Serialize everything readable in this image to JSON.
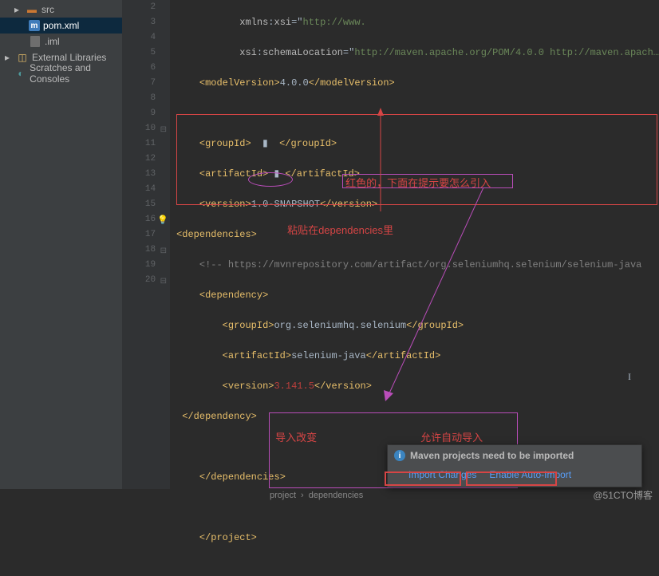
{
  "sidebar": {
    "items": [
      {
        "label": "src"
      },
      {
        "label": "pom.xml"
      },
      {
        "label": ".iml"
      },
      {
        "label": "External Libraries"
      },
      {
        "label": "Scratches and Consoles"
      }
    ]
  },
  "gutter": {
    "start": 2,
    "lines": [
      "2",
      "3",
      "4",
      "5",
      "6",
      "7",
      "8",
      "9",
      "10",
      "11",
      "12",
      "13",
      "14",
      "15",
      "16",
      "17",
      "18",
      "19",
      "20"
    ]
  },
  "code": {
    "l2": {
      "attr": "xmlns",
      "pre": ":",
      "attr2": "xsi",
      "eq": "=\"",
      "url": "http://www."
    },
    "l3": {
      "attr": "xsi",
      "pre": ":",
      "attr2": "schemaLocation",
      "eq": "=\"",
      "url": "http://maven.apache.org/POM/4.0.0 http://maven.apach…"
    },
    "l4": {
      "open": "<modelVersion>",
      "val": "4.0.0",
      "close": "</modelVersion>"
    },
    "l7": {
      "open": "<groupId>",
      "val": "",
      "close": "</groupId>"
    },
    "l8": {
      "open": "<artifactId>",
      "val": "",
      "close": "</artifactId>"
    },
    "l9": {
      "open": "<version>",
      "val": "1.0-SNAPSHOT",
      "close": "</version>"
    },
    "l10": {
      "tag": "<dependencies>"
    },
    "l11": {
      "cmt": "<!-- https://mvnrepository.com/artifact/org.seleniumhq.selenium/selenium-java"
    },
    "l12": {
      "tag": "<dependency>"
    },
    "l13": {
      "open": "<groupId>",
      "val": "org.seleniumhq.selenium",
      "close": "</groupId>"
    },
    "l14": {
      "open": "<artifactId>",
      "val": "selenium-java",
      "close": "</artifactId>"
    },
    "l15": {
      "open": "<version>",
      "val": "3.141.5",
      "close": "</version>"
    },
    "l16": {
      "tag": "</dependency>"
    },
    "l18": {
      "tag": "</dependencies>"
    },
    "l20": {
      "tag": "</project>"
    }
  },
  "annots": {
    "note15": "红色的，下面在提示要怎么引入",
    "paste": "粘贴在dependencies里",
    "importChange": "导入改变",
    "autoImport": "允许自动导入"
  },
  "popup": {
    "title": "Maven projects need to be imported",
    "action1": "Import Changes",
    "action2": "Enable Auto-Import"
  },
  "breadcrumb": {
    "a": "project",
    "b": "dependencies"
  },
  "watermark": "@51CTO博客"
}
